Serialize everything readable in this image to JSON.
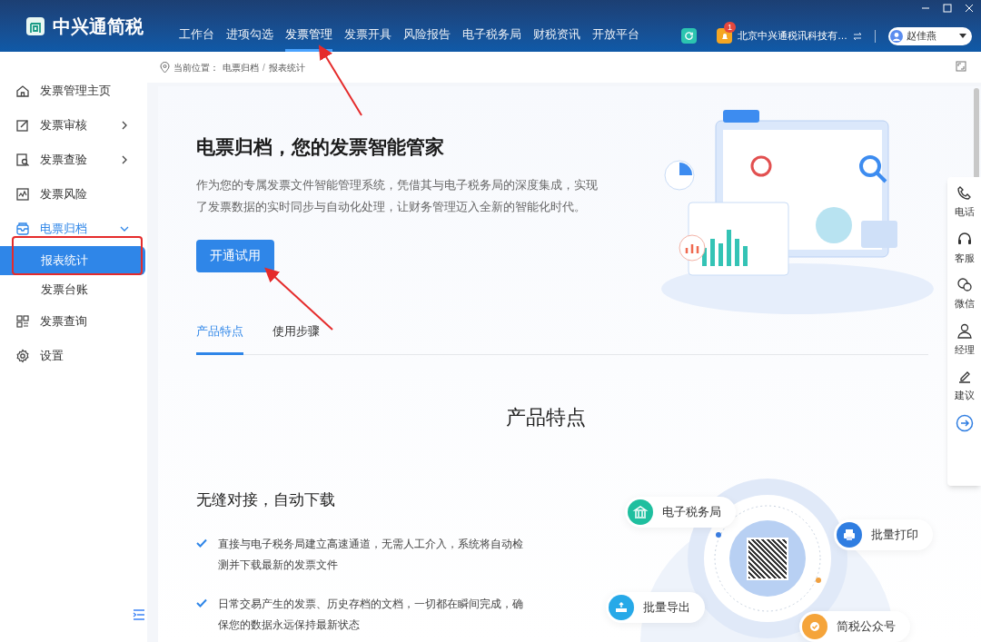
{
  "app": {
    "logo_text": "中兴通简税"
  },
  "nav": [
    {
      "label": "工作台",
      "selected": false
    },
    {
      "label": "进项勾选",
      "selected": false
    },
    {
      "label": "发票管理",
      "selected": true
    },
    {
      "label": "发票开具",
      "selected": false
    },
    {
      "label": "风险报告",
      "selected": false
    },
    {
      "label": "电子税务局",
      "selected": false
    },
    {
      "label": "财税资讯",
      "selected": false
    },
    {
      "label": "开放平台",
      "selected": false
    }
  ],
  "header": {
    "notification_count": "1",
    "company": "北京中兴通税讯科技有…",
    "user_name": "赵佳燕"
  },
  "sidebar": [
    {
      "label": "发票管理主页",
      "kind": "link",
      "selected": false
    },
    {
      "label": "发票审核",
      "kind": "group",
      "expanded": false,
      "selected": false
    },
    {
      "label": "发票查验",
      "kind": "group",
      "expanded": false,
      "selected": false
    },
    {
      "label": "发票风险",
      "kind": "link",
      "selected": false
    },
    {
      "label": "电票归档",
      "kind": "group",
      "expanded": true,
      "selected": true,
      "children": [
        {
          "label": "报表统计",
          "selected": true
        },
        {
          "label": "发票台账",
          "selected": false
        }
      ]
    },
    {
      "label": "发票查询",
      "kind": "link",
      "selected": false
    },
    {
      "label": "设置",
      "kind": "link",
      "selected": false
    }
  ],
  "breadcrumb": {
    "prefix": "当前位置：",
    "path": [
      "电票归档",
      "报表统计"
    ],
    "separator": "/"
  },
  "hero": {
    "title": "电票归档，您的发票智能管家",
    "description": "作为您的专属发票文件智能管理系统，凭借其与电子税务局的深度集成，实现了发票数据的实时同步与自动化处理，让财务管理迈入全新的智能化时代。",
    "button": "开通试用"
  },
  "tabs": [
    {
      "label": "产品特点",
      "selected": true
    },
    {
      "label": "使用步骤",
      "selected": false
    }
  ],
  "section_title": "产品特点",
  "feature": {
    "title": "无缝对接，自动下载",
    "bullets": [
      "直接与电子税务局建立高速通道，无需人工介入，系统将自动检测并下载最新的发票文件",
      "日常交易产生的发票、历史存档的文档，一切都在瞬间完成，确保您的数据永远保持最新状态"
    ]
  },
  "diagram_nodes": [
    {
      "label": "电子税务局",
      "color": "#1fbf9f"
    },
    {
      "label": "批量打印",
      "color": "#2f7de1"
    },
    {
      "label": "批量导出",
      "color": "#27a9e8"
    },
    {
      "label": "简税公众号",
      "color": "#f5a43a"
    }
  ],
  "side_tools": [
    {
      "label": "电话"
    },
    {
      "label": "客服"
    },
    {
      "label": "微信"
    },
    {
      "label": "经理"
    },
    {
      "label": "建议"
    }
  ]
}
